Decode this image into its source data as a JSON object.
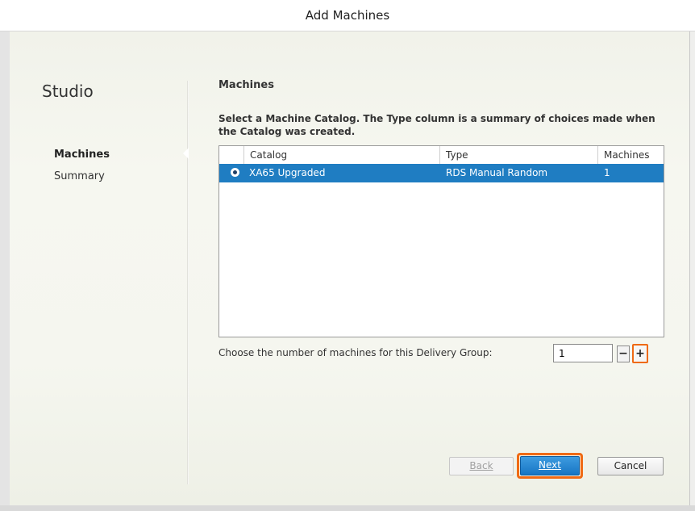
{
  "window": {
    "title": "Add Machines"
  },
  "sidebar": {
    "app_name": "Studio",
    "items": [
      {
        "label": "Machines",
        "active": true
      },
      {
        "label": "Summary",
        "active": false
      }
    ]
  },
  "main": {
    "section_title": "Machines",
    "instructions": "Select a Machine Catalog. The Type column is a summary of choices made when the Catalog was created.",
    "table": {
      "columns": [
        "Catalog",
        "Type",
        "Machines"
      ],
      "rows": [
        {
          "selected": true,
          "catalog": "XA65 Upgraded",
          "type": "RDS Manual Random",
          "machines": "1"
        }
      ]
    },
    "machine_count": {
      "label": "Choose the number of machines for this Delivery Group:",
      "value": "1",
      "decrement_label": "−",
      "increment_label": "+"
    }
  },
  "footer": {
    "back_label": "Back",
    "next_label": "Next",
    "cancel_label": "Cancel"
  },
  "colors": {
    "selection": "#1f7dc2",
    "highlight": "#ef6a14",
    "primary_button": "#1876c4"
  }
}
